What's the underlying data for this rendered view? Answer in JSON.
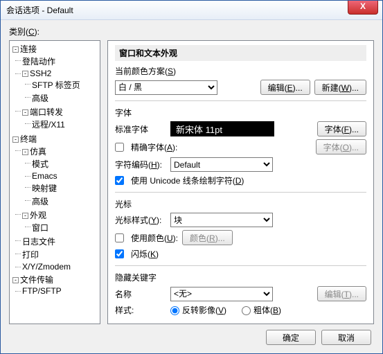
{
  "window": {
    "title": "会话选项 - Default",
    "close": "X"
  },
  "category_label": "类别(",
  "category_key": "C",
  "category_label_end": "):",
  "tree": {
    "connect": "连接",
    "login": "登陆动作",
    "ssh2": "SSH2",
    "sftp": "SFTP 标签页",
    "advanced": "高级",
    "portfwd": "端口转发",
    "remote": "远程/X11",
    "terminal": "终端",
    "emulation": "仿真",
    "mode": "模式",
    "emacs": "Emacs",
    "mapkeys": "映射键",
    "adv2": "高级",
    "appearance": "外观",
    "window": "窗口",
    "logfile": "日志文件",
    "print": "打印",
    "xyz": "X/Y/Zmodem",
    "filetrans": "文件传输",
    "ftp": "FTP/SFTP"
  },
  "panel": {
    "title": "窗口和文本外观",
    "scheme_label": "当前颜色方案(",
    "scheme_key": "S",
    "scheme_end": ")",
    "scheme_value": "白 / 黑",
    "edit_btn": "编辑(",
    "edit_key": "E",
    "edit_end": ")...",
    "new_btn": "新建(",
    "new_key": "W",
    "new_end": ")...",
    "fonts_header": "字体",
    "stdfont_label": "标准字体",
    "stdfont_display": "新宋体  11pt",
    "font_btn": "字体(",
    "font_key": "F",
    "font_end": ")...",
    "precise_label": "精确字体(",
    "precise_key": "A",
    "precise_end": "):",
    "font_btn2": "字体(",
    "font_key2": "O",
    "font_end2": ")...",
    "charenc_label": "字符编码(",
    "charenc_key": "H",
    "charenc_end": "):",
    "charenc_value": "Default",
    "unicode_label": "使用 Unicode 线条绘制字符(",
    "unicode_key": "D",
    "unicode_end": ")",
    "cursor_header": "光标",
    "cursorstyle_label": "光标样式(",
    "cursorstyle_key": "Y",
    "cursorstyle_end": "):",
    "cursorstyle_value": "块",
    "usecolor_label": "使用颜色(",
    "usecolor_key": "U",
    "usecolor_end": "):",
    "color_btn": "颜色(",
    "color_key": "R",
    "color_end": ")...",
    "blink_label": "闪烁(",
    "blink_key": "K",
    "blink_end": ")",
    "hidden_header": "隐藏关键字",
    "name_label": "名称",
    "name_value": "<无>",
    "edit2_btn": "编辑(",
    "edit2_key": "T",
    "edit2_end": ")...",
    "style_label": "样式:",
    "style_reverse": "反转影像(",
    "style_reverse_key": "V",
    "style_reverse_end": ")",
    "style_bold": "粗体(",
    "style_bold_key": "B",
    "style_bold_end": ")"
  },
  "footer": {
    "ok": "确定",
    "cancel": "取消"
  },
  "glyph": {
    "minus": "-"
  }
}
